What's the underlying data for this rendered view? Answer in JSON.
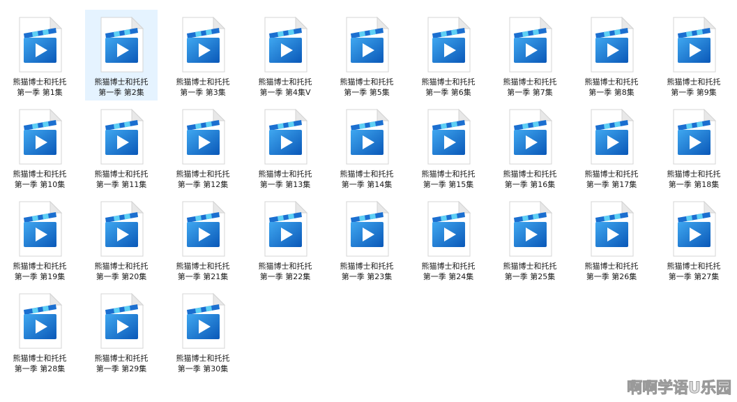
{
  "files": [
    {
      "line1": "熊猫博士和托托",
      "line2": "第一季 第1集"
    },
    {
      "line1": "熊猫博士和托托",
      "line2": "第一季 第2集",
      "selected": true
    },
    {
      "line1": "熊猫博士和托托",
      "line2": "第一季 第3集"
    },
    {
      "line1": "熊猫博士和托托",
      "line2": "第一季 第4集V"
    },
    {
      "line1": "熊猫博士和托托",
      "line2": "第一季 第5集"
    },
    {
      "line1": "熊猫博士和托托",
      "line2": "第一季 第6集"
    },
    {
      "line1": "熊猫博士和托托",
      "line2": "第一季 第7集"
    },
    {
      "line1": "熊猫博士和托托",
      "line2": "第一季 第8集"
    },
    {
      "line1": "熊猫博士和托托",
      "line2": "第一季 第9集"
    },
    {
      "line1": "熊猫博士和托托",
      "line2": "第一季 第10集"
    },
    {
      "line1": "熊猫博士和托托",
      "line2": "第一季 第11集"
    },
    {
      "line1": "熊猫博士和托托",
      "line2": "第一季 第12集"
    },
    {
      "line1": "熊猫博士和托托",
      "line2": "第一季 第13集"
    },
    {
      "line1": "熊猫博士和托托",
      "line2": "第一季 第14集"
    },
    {
      "line1": "熊猫博士和托托",
      "line2": "第一季 第15集"
    },
    {
      "line1": "熊猫博士和托托",
      "line2": "第一季 第16集"
    },
    {
      "line1": "熊猫博士和托托",
      "line2": "第一季 第17集"
    },
    {
      "line1": "熊猫博士和托托",
      "line2": "第一季 第18集"
    },
    {
      "line1": "熊猫博士和托托",
      "line2": "第一季 第19集"
    },
    {
      "line1": "熊猫博士和托托",
      "line2": "第一季 第20集"
    },
    {
      "line1": "熊猫博士和托托",
      "line2": "第一季 第21集"
    },
    {
      "line1": "熊猫博士和托托",
      "line2": "第一季 第22集"
    },
    {
      "line1": "熊猫博士和托托",
      "line2": "第一季 第23集"
    },
    {
      "line1": "熊猫博士和托托",
      "line2": "第一季 第24集"
    },
    {
      "line1": "熊猫博士和托托",
      "line2": "第一季 第25集"
    },
    {
      "line1": "熊猫博士和托托",
      "line2": "第一季 第26集"
    },
    {
      "line1": "熊猫博士和托托",
      "line2": "第一季 第27集"
    },
    {
      "line1": "熊猫博士和托托",
      "line2": "第一季 第28集"
    },
    {
      "line1": "熊猫博士和托托",
      "line2": "第一季 第29集"
    },
    {
      "line1": "熊猫博士和托托",
      "line2": "第一季 第30集"
    }
  ],
  "icon": "video-file-icon",
  "colors": {
    "selection": "#e5f3ff",
    "icon_blue_dark": "#0a58b8",
    "icon_blue_light": "#3fa7f0",
    "icon_stripe": "#5ed0f5",
    "page_fold": "#e8e8e8"
  },
  "watermark": "啊啊学语U乐园"
}
